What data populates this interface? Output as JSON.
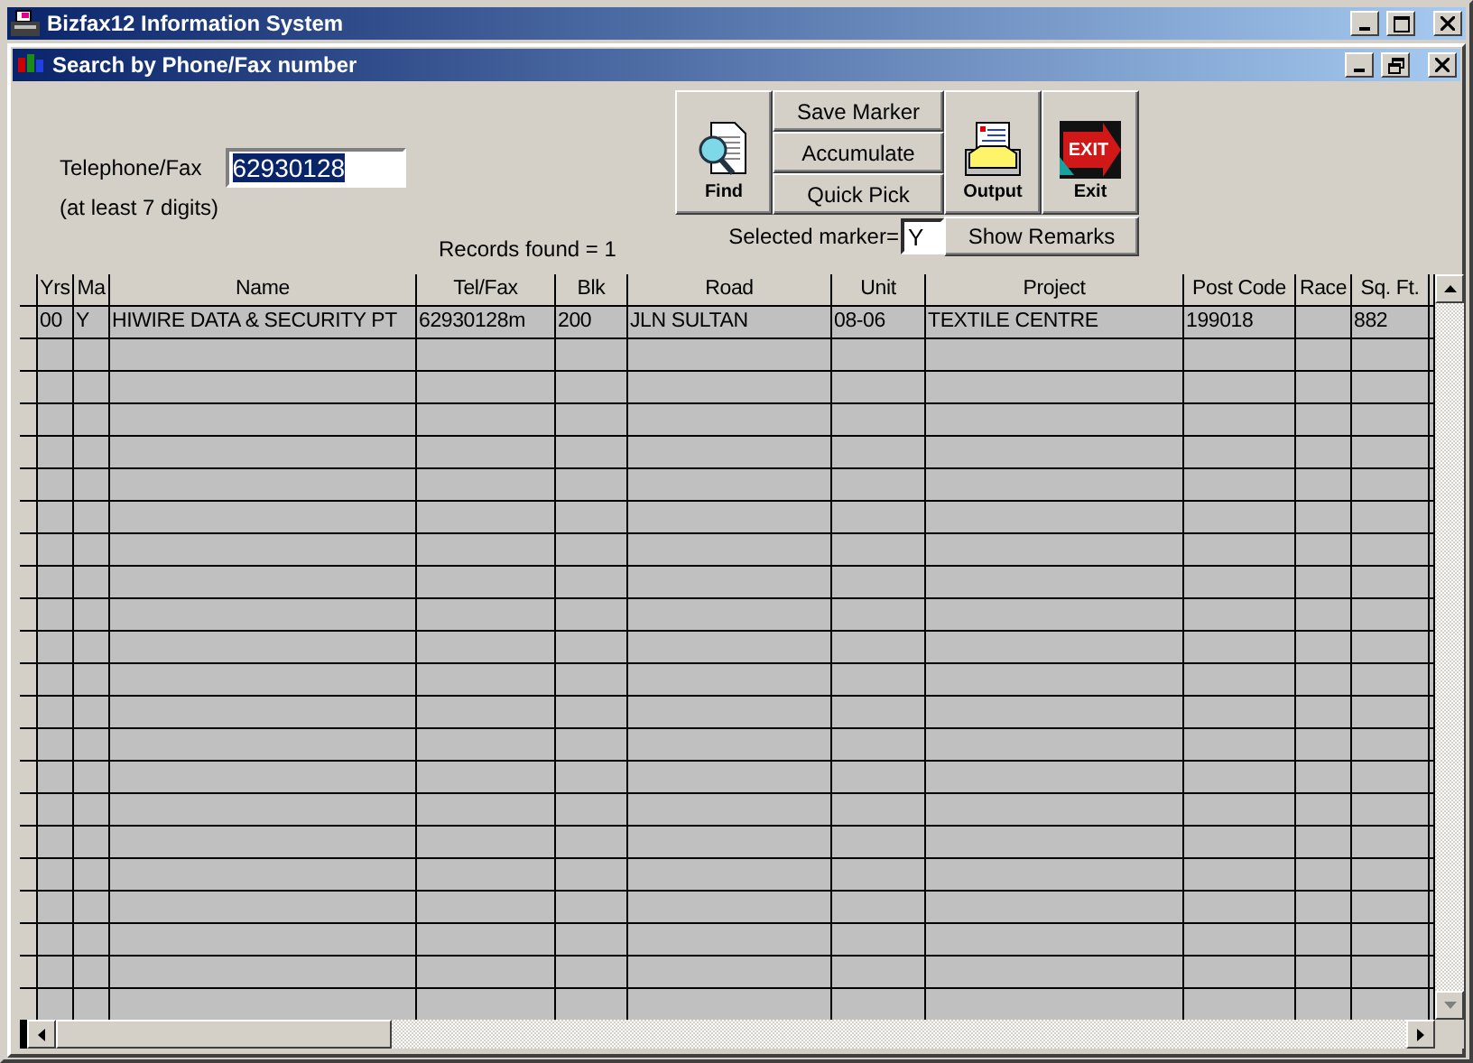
{
  "app_window": {
    "title": "Bizfax12 Information System"
  },
  "child_window": {
    "title": "Search by Phone/Fax number"
  },
  "search": {
    "label": "Telephone/Fax",
    "value": "62930128",
    "hint": "(at least 7 digits)"
  },
  "records_found": "Records found =  1",
  "selected_marker": {
    "label": "Selected marker=",
    "value": "Y"
  },
  "toolbar": {
    "find": "Find",
    "stack": [
      "Save Marker",
      "Accumulate",
      "Quick Pick"
    ],
    "output": "Output",
    "exit": "Exit",
    "exit_sign": "EXIT",
    "show_remarks": "Show Remarks"
  },
  "table": {
    "columns": [
      "Yrs",
      "Ma",
      "Name",
      "Tel/Fax",
      "Blk",
      "Road",
      "Unit",
      "Project",
      "Post Code",
      "Race",
      "Sq. Ft."
    ],
    "rows": [
      [
        "00",
        "Y",
        "HIWIRE DATA & SECURITY PT",
        "62930128m",
        "200",
        "JLN SULTAN",
        "08-06",
        "TEXTILE CENTRE",
        "199018",
        null,
        "882"
      ]
    ]
  }
}
